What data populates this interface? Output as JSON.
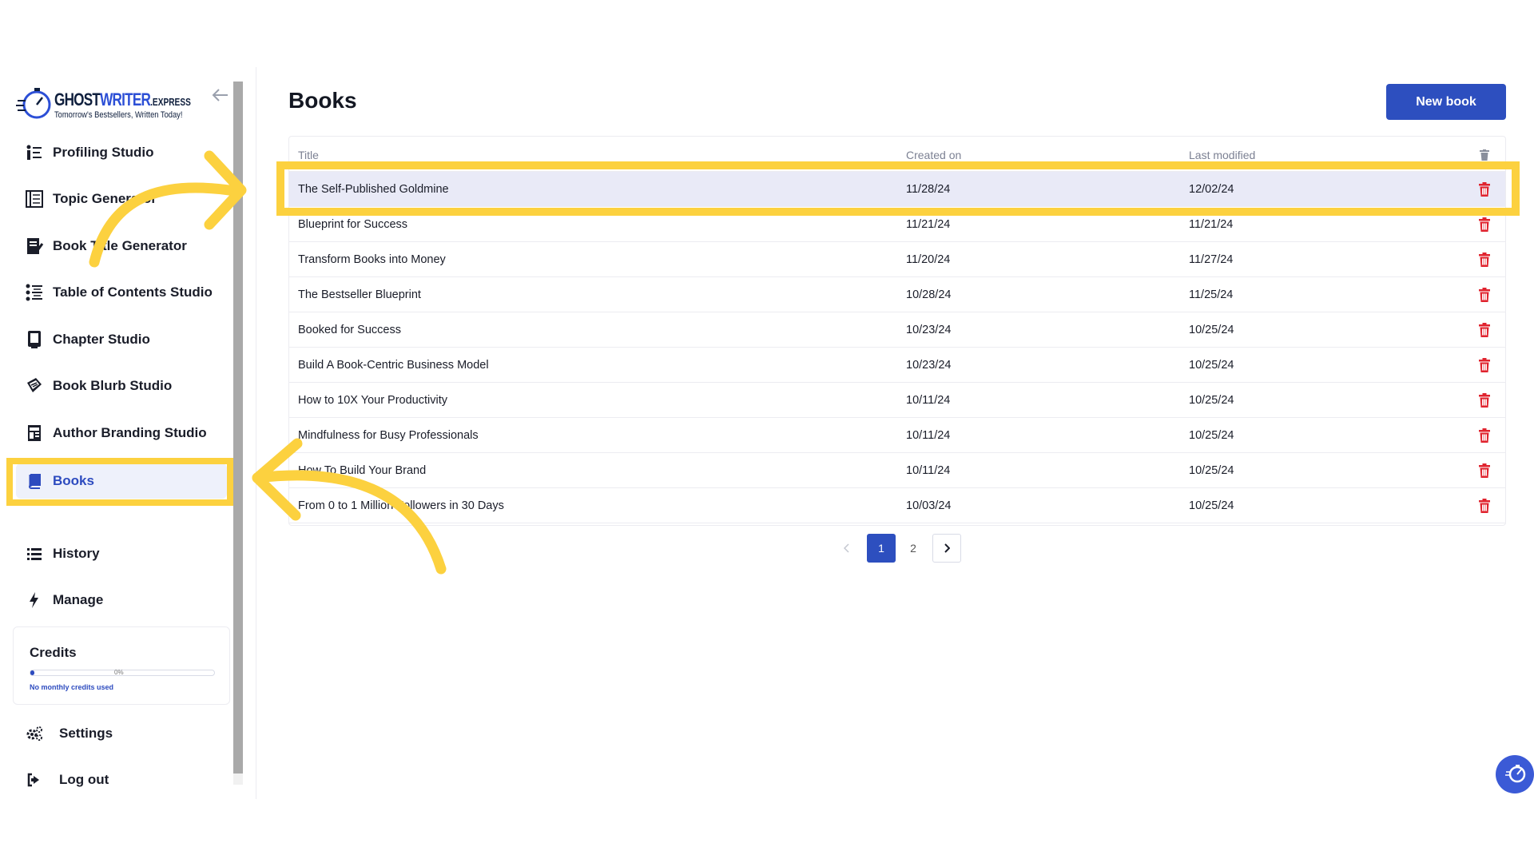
{
  "logo": {
    "brand_main": "GHOST",
    "brand_accent": "WRITER",
    "brand_suffix": ".EXPRESS",
    "tagline": "Tomorrow's Bestsellers, Written Today!"
  },
  "sidebar": {
    "items": [
      {
        "label": "Profiling Studio",
        "icon": "profiling-icon"
      },
      {
        "label": "Topic Generator",
        "icon": "topic-icon"
      },
      {
        "label": "Book Title Generator",
        "icon": "book-title-icon"
      },
      {
        "label": "Table of Contents Studio",
        "icon": "toc-icon"
      },
      {
        "label": "Chapter Studio",
        "icon": "chapter-icon"
      },
      {
        "label": "Book Blurb Studio",
        "icon": "blurb-icon"
      },
      {
        "label": "Author Branding Studio",
        "icon": "branding-icon"
      },
      {
        "label": "Books",
        "icon": "book-icon"
      },
      {
        "label": "History",
        "icon": "list-icon"
      },
      {
        "label": "Manage",
        "icon": "bolt-icon"
      }
    ],
    "credits": {
      "title": "Credits",
      "percent_label": "0%",
      "progress": 0.02,
      "note": "No monthly credits used"
    },
    "footer": [
      {
        "label": "Settings",
        "icon": "gears-icon"
      },
      {
        "label": "Log out",
        "icon": "logout-icon"
      }
    ]
  },
  "main": {
    "title": "Books",
    "new_book_label": "New book",
    "table": {
      "columns": [
        "Title",
        "Created on",
        "Last modified"
      ],
      "rows": [
        {
          "title": "The Self-Published Goldmine",
          "created": "11/28/24",
          "modified": "12/02/24"
        },
        {
          "title": "Blueprint for Success",
          "created": "11/21/24",
          "modified": "11/21/24"
        },
        {
          "title": "Transform Books into Money",
          "created": "11/20/24",
          "modified": "11/27/24"
        },
        {
          "title": "The Bestseller Blueprint",
          "created": "10/28/24",
          "modified": "11/25/24"
        },
        {
          "title": "Booked for Success",
          "created": "10/23/24",
          "modified": "10/25/24"
        },
        {
          "title": "Build A Book-Centric Business Model",
          "created": "10/23/24",
          "modified": "10/25/24"
        },
        {
          "title": "How to 10X Your Productivity",
          "created": "10/11/24",
          "modified": "10/25/24"
        },
        {
          "title": "Mindfulness for Busy Professionals",
          "created": "10/11/24",
          "modified": "10/25/24"
        },
        {
          "title": "How To Build Your Brand",
          "created": "10/11/24",
          "modified": "10/25/24"
        },
        {
          "title": "From 0 to 1 Million Followers in 30 Days",
          "created": "10/03/24",
          "modified": "10/25/24"
        }
      ]
    },
    "pagination": {
      "pages": [
        "1",
        "2"
      ],
      "current": "1"
    }
  },
  "colors": {
    "accent": "#2d4fbf",
    "highlight": "#fcd13f",
    "delete": "#e0232e",
    "selected_row": "#e9eaf7"
  }
}
